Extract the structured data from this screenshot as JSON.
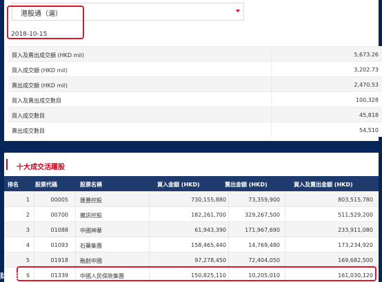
{
  "filter": {
    "selected": "港股通（滬）"
  },
  "date": "2018-10-15",
  "stats": [
    {
      "label": "買入及賣出成交額 (HKD mil)",
      "value": "5,673.26"
    },
    {
      "label": "買入成交額 (HKD mil)",
      "value": "3,202.73"
    },
    {
      "label": "賣出成交額 (HKD mil)",
      "value": "2,470.53"
    },
    {
      "label": "買入及賣出成交數目",
      "value": "100,328"
    },
    {
      "label": "買入成交數目",
      "value": "45,818"
    },
    {
      "label": "賣出成交數目",
      "value": "54,510"
    }
  ],
  "section": {
    "title": "十大成交活躍股"
  },
  "table": {
    "headers": [
      "排名",
      "股票代碼",
      "股票名稱",
      "買入金額 (HKD)",
      "賣出金額 (HKD)",
      "買入及賣出金額 (HKD)"
    ],
    "rows": [
      {
        "rank": "1",
        "code": "00005",
        "name": "匯豐控股",
        "buy": "730,155,880",
        "sell": "73,359,900",
        "total": "803,515,780"
      },
      {
        "rank": "2",
        "code": "00700",
        "name": "騰訊控股",
        "buy": "182,261,700",
        "sell": "329,267,500",
        "total": "511,529,200"
      },
      {
        "rank": "3",
        "code": "01088",
        "name": "中國神華",
        "buy": "61,943,390",
        "sell": "171,967,690",
        "total": "233,911,080"
      },
      {
        "rank": "4",
        "code": "01093",
        "name": "石藥集團",
        "buy": "158,465,440",
        "sell": "14,769,480",
        "total": "173,234,920"
      },
      {
        "rank": "5",
        "code": "01918",
        "name": "融創中國",
        "buy": "97,278,450",
        "sell": "72,404,050",
        "total": "169,682,500"
      },
      {
        "rank": "6",
        "code": "01339",
        "name": "中國人民保險集團",
        "buy": "150,825,110",
        "sell": "10,205,010",
        "total": "161,030,120"
      }
    ]
  },
  "watermark": "财经日历"
}
